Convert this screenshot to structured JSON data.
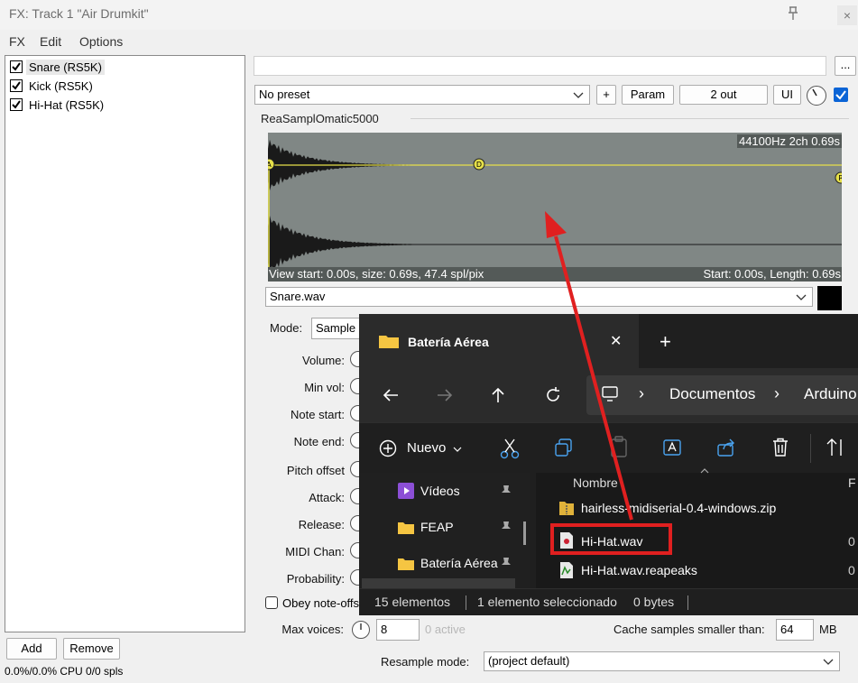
{
  "window": {
    "title": "FX: Track 1 \"Air Drumkit\"",
    "close_glyph": "×"
  },
  "menu": [
    "FX",
    "Edit",
    "Options"
  ],
  "fx_list": [
    {
      "label": "Snare (RS5K)",
      "checked": true
    },
    {
      "label": "Kick (RS5K)",
      "checked": true
    },
    {
      "label": "Hi-Hat (RS5K)",
      "checked": true
    }
  ],
  "buttons": {
    "add": "Add",
    "remove": "Remove",
    "more": "...",
    "plus": "+",
    "param": "Param",
    "out": "2 out",
    "ui": "UI"
  },
  "status": "0.0%/0.0% CPU 0/0 spls",
  "preset": {
    "value": "No preset"
  },
  "plugin_name": "ReaSamplOmatic5000",
  "waveform": {
    "info": "44100Hz 2ch 0.69s",
    "view": "View start: 0.00s, size: 0.69s, 47.4 spl/pix",
    "start": "Start: 0.00s, Length: 0.69s",
    "markers": [
      "A",
      "D",
      "R"
    ]
  },
  "sample_file": "Snare.wav",
  "mode": {
    "label": "Mode:",
    "value": "Sample"
  },
  "params": [
    "Volume:",
    "Min vol:",
    "Note start:",
    "Note end:",
    "Pitch offset",
    "Attack:",
    "Release:",
    "MIDI Chan:",
    "Probability:"
  ],
  "obey_label": "Obey note-offs",
  "max_voices": {
    "label": "Max voices:",
    "value": "8",
    "active": "0 active"
  },
  "cache": {
    "label": "Cache samples smaller than:",
    "value": "64",
    "unit": "MB"
  },
  "resample": {
    "label": "Resample mode:",
    "value": "(project default)"
  },
  "explorer": {
    "tab_title": "Batería Aérea",
    "tab_close": "✕",
    "tab_new": "+",
    "breadcrumb": [
      "Documentos",
      "Arduino"
    ],
    "new_button": "Nuevo",
    "sidebar": [
      "Vídeos",
      "FEAP",
      "Batería Aérea"
    ],
    "column_header": "Nombre",
    "column_header2": "F",
    "files": [
      {
        "name": "hairless-midiserial-0.4-windows.zip",
        "col": ""
      },
      {
        "name": "Hi-Hat.wav",
        "col": "0"
      },
      {
        "name": "Hi-Hat.wav.reapeaks",
        "col": "0"
      }
    ],
    "status_count": "15 elementos",
    "status_selected": "1 elemento seleccionado",
    "status_size": "0 bytes"
  },
  "colors": {
    "accent_red": "#e02020",
    "blue_check": "#0a64d6",
    "explorer_bg": "#1f1f1f"
  }
}
